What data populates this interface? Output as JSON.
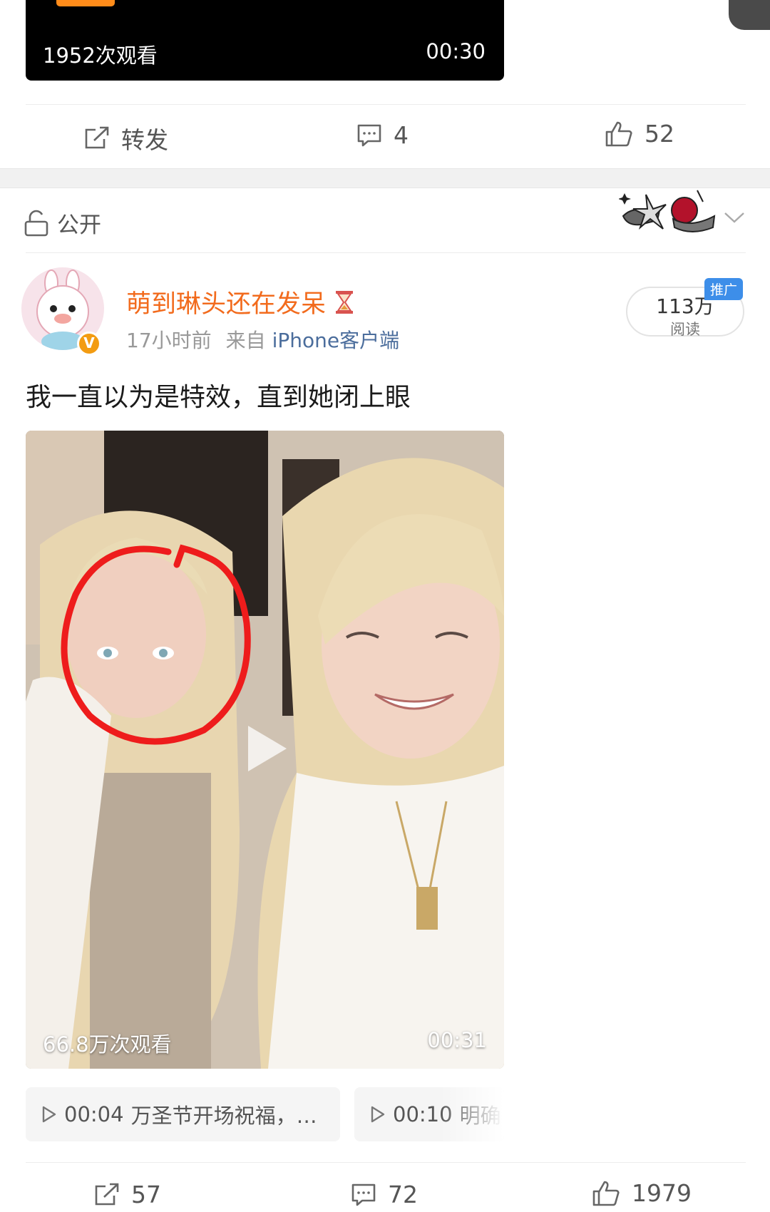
{
  "prev_post": {
    "video": {
      "views": "1952次观看",
      "duration": "00:30"
    },
    "actions": {
      "repost": "转发",
      "comments": "4",
      "likes": "52"
    }
  },
  "privacy": {
    "icon": "unlock-icon",
    "label": "公开"
  },
  "post": {
    "author": {
      "name": "萌到琳头还在发呆",
      "emoji": "hourglass-icon",
      "verified_badge": "V"
    },
    "time": "17小时前",
    "source_prefix": "来自",
    "source_client": "iPhone客户端",
    "reads": {
      "count": "113万",
      "label": "阅读",
      "tag": "推广"
    },
    "text": "我一直以为是特效，直到她闭上眼",
    "video": {
      "views": "66.8万次观看",
      "duration": "00:31"
    },
    "chapters": [
      {
        "time": "00:04",
        "title": "万圣节开场祝福，…"
      },
      {
        "time": "00:10",
        "title": "明确"
      }
    ],
    "actions": {
      "reposts": "57",
      "comments": "72",
      "likes": "1979"
    }
  },
  "colors": {
    "accent_orange": "#f26b1d",
    "link_blue": "#4b6d9c",
    "promo_blue": "#3d8ee9",
    "progress_orange": "#ff8c1a"
  }
}
